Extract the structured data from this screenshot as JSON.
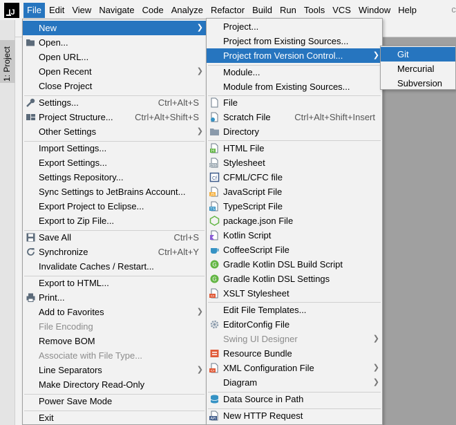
{
  "menubar": {
    "items": [
      "File",
      "Edit",
      "View",
      "Navigate",
      "Code",
      "Analyze",
      "Refactor",
      "Build",
      "Run",
      "Tools",
      "VCS",
      "Window",
      "Help"
    ],
    "right_text": "clo"
  },
  "side": {
    "project_tab": "1: Project"
  },
  "file_menu": {
    "new": "New",
    "open": "Open...",
    "open_url": "Open URL...",
    "open_recent": "Open Recent",
    "close_project": "Close Project",
    "settings": "Settings...",
    "settings_shortcut": "Ctrl+Alt+S",
    "project_structure": "Project Structure...",
    "project_structure_shortcut": "Ctrl+Alt+Shift+S",
    "other_settings": "Other Settings",
    "import_settings": "Import Settings...",
    "export_settings": "Export Settings...",
    "settings_repository": "Settings Repository...",
    "sync_settings": "Sync Settings to JetBrains Account...",
    "export_eclipse": "Export Project to Eclipse...",
    "export_zip": "Export to Zip File...",
    "save_all": "Save All",
    "save_all_shortcut": "Ctrl+S",
    "synchronize": "Synchronize",
    "synchronize_shortcut": "Ctrl+Alt+Y",
    "invalidate_caches": "Invalidate Caches / Restart...",
    "export_html": "Export to HTML...",
    "print": "Print...",
    "add_favorites": "Add to Favorites",
    "file_encoding": "File Encoding",
    "remove_bom": "Remove BOM",
    "associate_file_type": "Associate with File Type...",
    "line_separators": "Line Separators",
    "make_read_only": "Make Directory Read-Only",
    "power_save": "Power Save Mode",
    "exit": "Exit"
  },
  "new_menu": {
    "project": "Project...",
    "project_existing": "Project from Existing Sources...",
    "project_vcs": "Project from Version Control...",
    "module": "Module...",
    "module_existing": "Module from Existing Sources...",
    "file": "File",
    "scratch_file": "Scratch File",
    "scratch_shortcut": "Ctrl+Alt+Shift+Insert",
    "directory": "Directory",
    "html_file": "HTML File",
    "stylesheet": "Stylesheet",
    "cfml_file": "CFML/CFC file",
    "javascript_file": "JavaScript File",
    "typescript_file": "TypeScript File",
    "package_json": "package.json File",
    "kotlin_script": "Kotlin Script",
    "coffeescript_file": "CoffeeScript File",
    "gradle_kotlin_build": "Gradle Kotlin DSL Build Script",
    "gradle_kotlin_settings": "Gradle Kotlin DSL Settings",
    "xslt_stylesheet": "XSLT Stylesheet",
    "edit_file_templates": "Edit File Templates...",
    "editorconfig_file": "EditorConfig File",
    "swing_ui_designer": "Swing UI Designer",
    "resource_bundle": "Resource Bundle",
    "xml_config_file": "XML Configuration File",
    "diagram": "Diagram",
    "data_source": "Data Source in Path",
    "http_request": "New HTTP Request"
  },
  "vcs_menu": {
    "git": "Git",
    "mercurial": "Mercurial",
    "subversion": "Subversion"
  },
  "icons": {
    "html": "H",
    "css": "CSS",
    "cfml": "Cf",
    "js": "JS",
    "ts": "TS",
    "kotlin": "K",
    "gradle": "G",
    "xslt": "<>",
    "api": "API"
  },
  "colors": {
    "highlight": "#2675bf",
    "menu_bg": "#f2f2f2",
    "disabled": "#8c8c8c"
  }
}
